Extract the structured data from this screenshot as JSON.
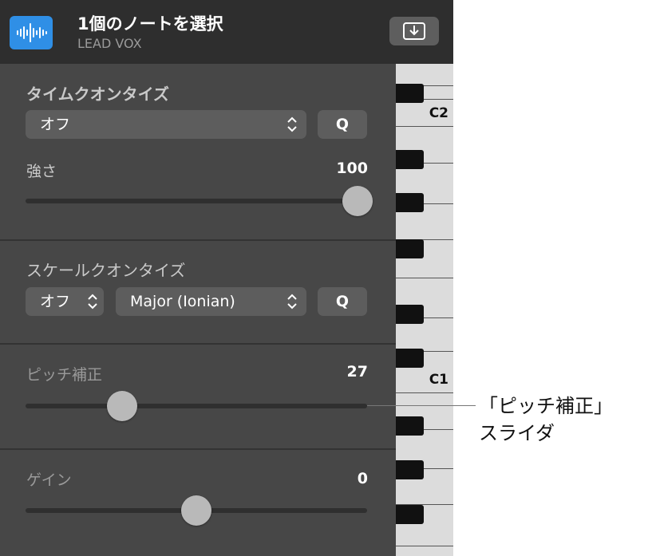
{
  "header": {
    "title": "1個のノートを選択",
    "subtitle": "LEAD VOX",
    "accent_color": "#2f8fe6",
    "icon": "waveform-icon",
    "button_icon": "download-tray-icon"
  },
  "time_quantize": {
    "title": "タイムクオンタイズ",
    "select_value": "オフ",
    "q_label": "Q",
    "strength_label": "強さ",
    "strength_value": "100",
    "strength_level": 1.0
  },
  "scale_quantize": {
    "title": "スケールクオンタイズ",
    "toggle_value": "オフ",
    "scale_value": "Major (Ionian)",
    "q_label": "Q"
  },
  "pitch_correction": {
    "label": "ピッチ補正",
    "value": "27",
    "level": 0.27
  },
  "gain": {
    "label": "ゲイン",
    "value": "0",
    "level": 0.5
  },
  "keyboard": {
    "label_c2": "C2",
    "label_c1": "C1"
  },
  "callout": {
    "line1": "「ピッチ補正」",
    "line2": "スライダ"
  }
}
